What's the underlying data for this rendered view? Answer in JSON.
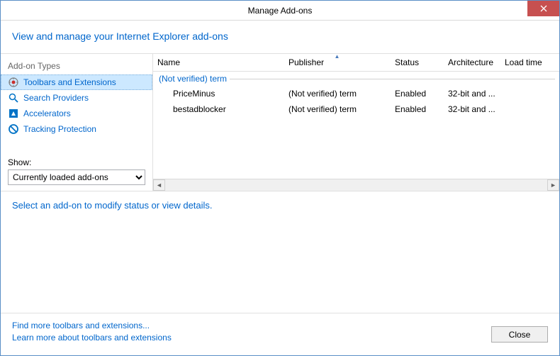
{
  "window": {
    "title": "Manage Add-ons"
  },
  "header": {
    "title": "View and manage your Internet Explorer add-ons"
  },
  "sidebar": {
    "types_label": "Add-on Types",
    "items": [
      {
        "label": "Toolbars and Extensions"
      },
      {
        "label": "Search Providers"
      },
      {
        "label": "Accelerators"
      },
      {
        "label": "Tracking Protection"
      }
    ],
    "show_label": "Show:",
    "show_selected": "Currently loaded add-ons"
  },
  "table": {
    "columns": {
      "name": "Name",
      "publisher": "Publisher",
      "status": "Status",
      "architecture": "Architecture",
      "load_time": "Load time"
    },
    "group": "(Not verified) term",
    "rows": [
      {
        "name": "PriceMinus",
        "publisher": "(Not verified) term",
        "status": "Enabled",
        "architecture": "32-bit and ..."
      },
      {
        "name": "bestadblocker",
        "publisher": "(Not verified) term",
        "status": "Enabled",
        "architecture": "32-bit and ..."
      }
    ]
  },
  "details": {
    "hint": "Select an add-on to modify status or view details."
  },
  "footer": {
    "links": [
      "Find more toolbars and extensions...",
      "Learn more about toolbars and extensions"
    ],
    "close": "Close"
  }
}
